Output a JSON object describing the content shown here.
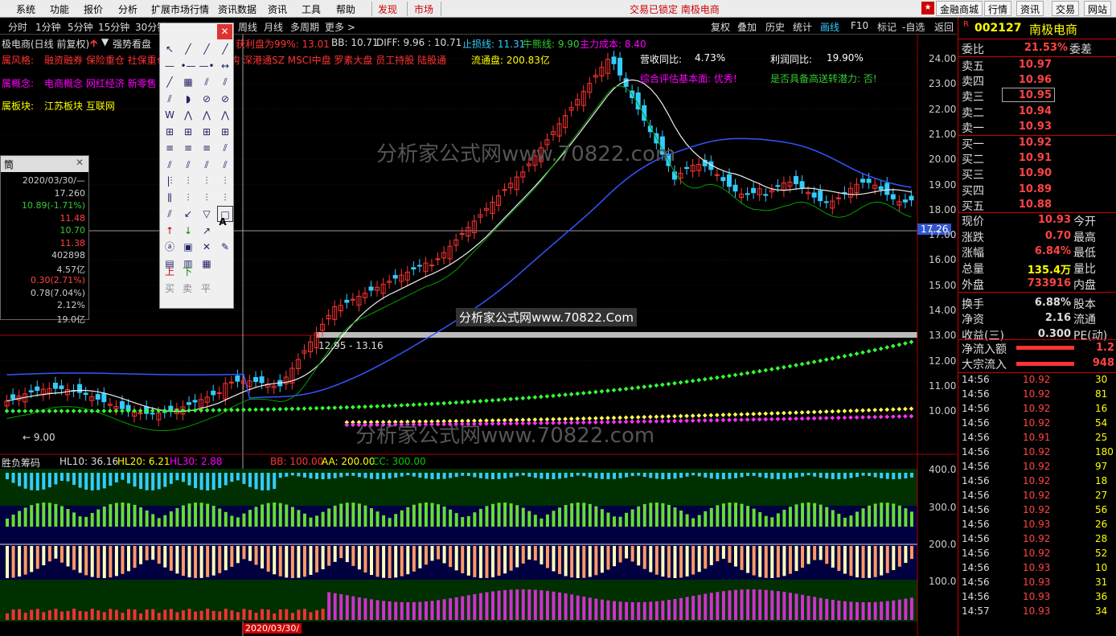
{
  "menubar": {
    "items": [
      "系统",
      "功能",
      "报价",
      "分析",
      "扩展市场行情",
      "资讯数据",
      "资讯",
      "工具",
      "帮助"
    ],
    "discover": "发现",
    "market": "市场",
    "lock_text": "交易已锁定 南极电商",
    "right_buttons": [
      "金融商城",
      "行情",
      "资讯",
      "交易",
      "网站"
    ]
  },
  "periods": {
    "items": [
      "分时",
      "1分钟",
      "5分钟",
      "15分钟",
      "30分钟",
      "周线",
      "月线",
      "多周期",
      "更多 >"
    ]
  },
  "chart_toolbar": [
    "复权",
    "叠加",
    "历史",
    "统计",
    "画线",
    "F10",
    "标记",
    "-自选",
    "返回"
  ],
  "chart_header": {
    "title": "极电商(日线 前复权)",
    "strategy": "强势看盘",
    "profit_label": "获利盘为99%: 13.01",
    "bb": "BB: 10.71",
    "diff": "DIFF: 9.96 : 10.71",
    "stop_label": "止损线: 11.31",
    "bull_label": "牛熊线: 9.90",
    "cost_label": "主力成本: 8.40"
  },
  "concepts": {
    "style_label": "属风格:",
    "style_value": "融资融券 保险重仓 社保重仓 高派息 股份回购 深港通SZ MSCI中盘 罗素大盘 员工持股 陆股通",
    "concept_label": "属概念:",
    "concept_value": "电商概念 网红经济 新零售",
    "sector_label": "属板块:",
    "sector_value": "江苏板块  互联网",
    "float_cap": "流通盘: 200.83亿"
  },
  "annotations": {
    "revenue_yoy_label": "营收同比:",
    "revenue_yoy": "4.73%",
    "profit_yoy_label": "利润同比:",
    "profit_yoy": "19.90%",
    "fundamental": "综合评估基本面: 优秀!",
    "high_dividend": "是否具备高送转潜力: 否!",
    "price_band": "12.95 - 13.16",
    "low_mark": "← 9.00",
    "cursor_price": "17.26",
    "watermark_1": "分析家公式网www.70822.com",
    "watermark_2": "分析家公式网www.70822.Com",
    "watermark_3": "分析家公式网www.70822.com",
    "bottom_date": "2020/03/30/"
  },
  "y_axis": [
    "24.00",
    "23.00",
    "22.00",
    "21.00",
    "20.00",
    "19.00",
    "18.00",
    "17.00",
    "16.00",
    "15.00",
    "14.00",
    "13.00",
    "12.00",
    "11.00",
    "10.00"
  ],
  "indicator": {
    "name": "胜负筹码",
    "hl10": "HL10: 36.16",
    "hl20": "HL20: 6.21",
    "hl30": "HL30: 2.88",
    "bb": "BB: 100.00",
    "aa": "AA: 200.00",
    "cc": "CC: 300.00",
    "y_axis": [
      "400.0",
      "300.0",
      "200.0",
      "100.0"
    ]
  },
  "popup": {
    "title": "筒",
    "rows": [
      {
        "v": "2020/03/30/—",
        "c": "#ccc"
      },
      {
        "v": "17.260",
        "c": "#ccc"
      },
      {
        "v": "10.89(-1.71%)",
        "c": "#3c3"
      },
      {
        "v": "11.48",
        "c": "#f44"
      },
      {
        "v": "10.70",
        "c": "#3c3"
      },
      {
        "v": "11.38",
        "c": "#f44"
      },
      {
        "v": "402898",
        "c": "#ccc"
      },
      {
        "v": "4.57亿",
        "c": "#ccc"
      },
      {
        "v": "0.30(2.71%)",
        "c": "#f44"
      },
      {
        "v": "0.78(7.04%)",
        "c": "#ccc"
      },
      {
        "v": "2.12%",
        "c": "#ccc"
      },
      {
        "v": "19.0亿",
        "c": "#ccc"
      }
    ]
  },
  "palette": {
    "text_tool": "A",
    "buy": "买",
    "sell": "卖",
    "flat": "平",
    "up": "上",
    "down": "下"
  },
  "quote": {
    "r": "R",
    "code": "002127",
    "name": "南极电商",
    "weibi_label": "委比",
    "weibi": "21.53%",
    "weicha_label": "委差",
    "asks": [
      {
        "label": "卖五",
        "price": "10.97"
      },
      {
        "label": "卖四",
        "price": "10.96"
      },
      {
        "label": "卖三",
        "price": "10.95"
      },
      {
        "label": "卖二",
        "price": "10.94"
      },
      {
        "label": "卖一",
        "price": "10.93"
      }
    ],
    "bids": [
      {
        "label": "买一",
        "price": "10.92"
      },
      {
        "label": "买二",
        "price": "10.91"
      },
      {
        "label": "买三",
        "price": "10.90"
      },
      {
        "label": "买四",
        "price": "10.89"
      },
      {
        "label": "买五",
        "price": "10.88"
      }
    ],
    "stats": [
      {
        "l": "现价",
        "v": "10.93",
        "c": "#f44",
        "r": "今开"
      },
      {
        "l": "涨跌",
        "v": "0.70",
        "c": "#f44",
        "r": "最高"
      },
      {
        "l": "涨幅",
        "v": "6.84%",
        "c": "#f44",
        "r": "最低"
      },
      {
        "l": "总量",
        "v": "135.4万",
        "c": "#ff0",
        "r": "量比"
      },
      {
        "l": "外盘",
        "v": "733916",
        "c": "#f44",
        "r": "内盘"
      },
      {
        "l": "换手",
        "v": "6.88%",
        "c": "#ddd",
        "r": "股本"
      },
      {
        "l": "净资",
        "v": "2.16",
        "c": "#ddd",
        "r": "流通"
      },
      {
        "l": "收益(三)",
        "v": "0.300",
        "c": "#ddd",
        "r": "PE(动)"
      }
    ],
    "net_inflow_label": "净流入额",
    "net_inflow_value": "1.2",
    "block_inflow_label": "大宗流入",
    "block_inflow_value": "948",
    "ticks": [
      {
        "t": "14:56",
        "p": "10.92",
        "v": "30"
      },
      {
        "t": "14:56",
        "p": "10.92",
        "v": "81"
      },
      {
        "t": "14:56",
        "p": "10.92",
        "v": "16"
      },
      {
        "t": "14:56",
        "p": "10.92",
        "v": "54"
      },
      {
        "t": "14:56",
        "p": "10.91",
        "v": "25"
      },
      {
        "t": "14:56",
        "p": "10.92",
        "v": "180"
      },
      {
        "t": "14:56",
        "p": "10.92",
        "v": "97"
      },
      {
        "t": "14:56",
        "p": "10.92",
        "v": "18"
      },
      {
        "t": "14:56",
        "p": "10.92",
        "v": "27"
      },
      {
        "t": "14:56",
        "p": "10.92",
        "v": "56"
      },
      {
        "t": "14:56",
        "p": "10.93",
        "v": "26"
      },
      {
        "t": "14:56",
        "p": "10.92",
        "v": "28"
      },
      {
        "t": "14:56",
        "p": "10.92",
        "v": "52"
      },
      {
        "t": "14:56",
        "p": "10.93",
        "v": "10"
      },
      {
        "t": "14:56",
        "p": "10.93",
        "v": "31"
      },
      {
        "t": "14:56",
        "p": "10.93",
        "v": "36"
      },
      {
        "t": "14:57",
        "p": "10.93",
        "v": "34"
      }
    ]
  },
  "colors": {
    "red": "#ff3333",
    "green": "#00d000",
    "cyan": "#3cf",
    "yellow": "#ff0",
    "magenta": "#f0f",
    "blue": "#3355ff"
  }
}
